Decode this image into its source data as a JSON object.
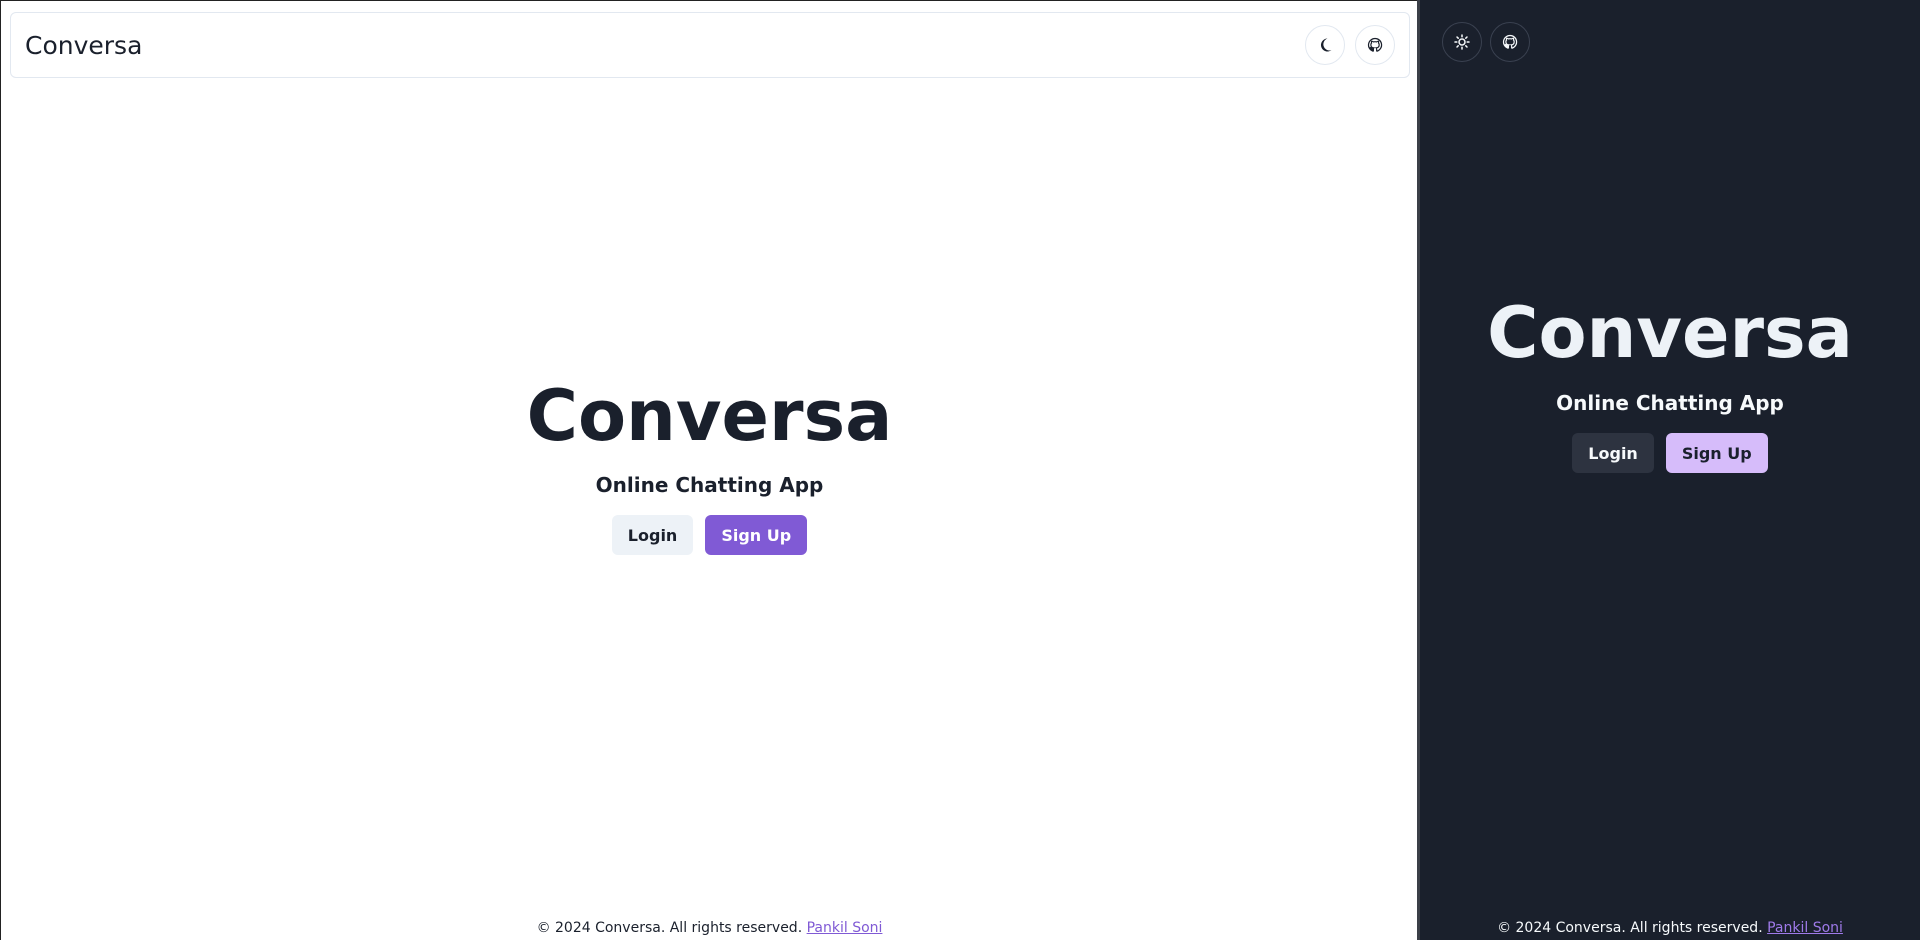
{
  "light": {
    "navbar": {
      "brand": "Conversa",
      "theme_toggle_icon": "moon-icon",
      "github_icon": "github-icon"
    },
    "hero": {
      "title": "Conversa",
      "subtitle": "Online Chatting App",
      "login_label": "Login",
      "signup_label": "Sign Up"
    },
    "footer": {
      "text": "© 2024 Conversa. All rights reserved.",
      "author_link": "Pankil Soni"
    }
  },
  "dark": {
    "toolbar": {
      "theme_toggle_icon": "sun-icon",
      "github_icon": "github-icon"
    },
    "hero": {
      "title": "Conversa",
      "subtitle": "Online Chatting App",
      "login_label": "Login",
      "signup_label": "Sign Up"
    },
    "footer": {
      "text": "© 2024 Conversa. All rights reserved.",
      "author_link": "Pankil Soni"
    }
  },
  "colors": {
    "accent_light": "#805ad5",
    "accent_dark": "#d6bcfa",
    "dark_bg": "#1a202c",
    "light_bg": "#ffffff"
  }
}
